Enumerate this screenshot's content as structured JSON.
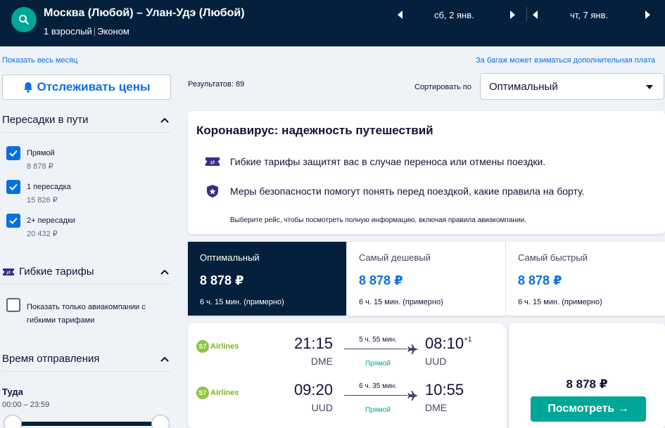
{
  "header": {
    "route": "Москва (Любой) – Улан-Удэ (Любой)",
    "passengers": "1 взрослый",
    "cabin": "Эконом",
    "depart_date": "сб, 2 янв.",
    "return_date": "чт, 7 янв."
  },
  "links": {
    "whole_month": "Показать весь месяц",
    "baggage": "За багаж может взиматься дополнительная плата"
  },
  "sidebar": {
    "track_prices": "Отслеживать цены",
    "stops_title": "Пересадки в пути",
    "stops": [
      {
        "label": "Прямой",
        "price": "8 878 ₽",
        "checked": true
      },
      {
        "label": "1 пересадка",
        "price": "15 826 ₽",
        "checked": true
      },
      {
        "label": "2+ пересадки",
        "price": "20 432 ₽",
        "checked": true
      }
    ],
    "flex_title": "Гибкие тарифы",
    "flex_option": "Показать только авиакомпании с гибкими тарифами",
    "depart_time_title": "Время отправления",
    "direction": "Туда",
    "time_range": "00:00 – 23:59"
  },
  "main": {
    "results": "Результатов: 89",
    "sort_label": "Сортировать по",
    "sort_value": "Оптимальный"
  },
  "covid": {
    "title": "Коронавирус: надежность путешествий",
    "row1": "Гибкие тарифы защитят вас в случае переноса или отмены поездки.",
    "row2": "Меры безопасности помогут понять перед поездкой, какие правила на борту.",
    "note": "Выберите рейс, чтобы посмотреть полную информацию, включая правила авиакомпании."
  },
  "sort_tabs": [
    {
      "name": "Оптимальный",
      "price": "8 878 ₽",
      "duration": "6 ч. 15 мин. (примерно)"
    },
    {
      "name": "Самый дешевый",
      "price": "8 878 ₽",
      "duration": "6 ч. 15 мин. (примерно)"
    },
    {
      "name": "Самый быстрый",
      "price": "8 878 ₽",
      "duration": "6 ч. 15 мин. (примерно)"
    }
  ],
  "ticket": {
    "legs": [
      {
        "airline": "Airlines",
        "logo": "S7",
        "dep_time": "21:15",
        "dep_code": "DME",
        "duration": "5 ч. 55 мин.",
        "stops": "Прямой",
        "arr_time": "08:10",
        "arr_offset": "+1",
        "arr_code": "UUD"
      },
      {
        "airline": "Airlines",
        "logo": "S7",
        "dep_time": "09:20",
        "dep_code": "UUD",
        "duration": "6 ч. 35 мин.",
        "stops": "Прямой",
        "arr_time": "10:55",
        "arr_offset": "",
        "arr_code": "DME"
      }
    ],
    "price": "8 878 ₽",
    "view_button": "Посмотреть →"
  },
  "colors": {
    "header_bg": "#05203c",
    "accent_blue": "#0770e3",
    "accent_teal": "#00a698",
    "s7_green": "#8cc63f"
  },
  "icons": [
    "search-icon",
    "chevron-left-icon",
    "chevron-right-icon",
    "bell-icon",
    "chevron-up-icon",
    "check-icon",
    "ticket-icon",
    "shield-icon",
    "caret-down-icon",
    "plane-icon"
  ]
}
